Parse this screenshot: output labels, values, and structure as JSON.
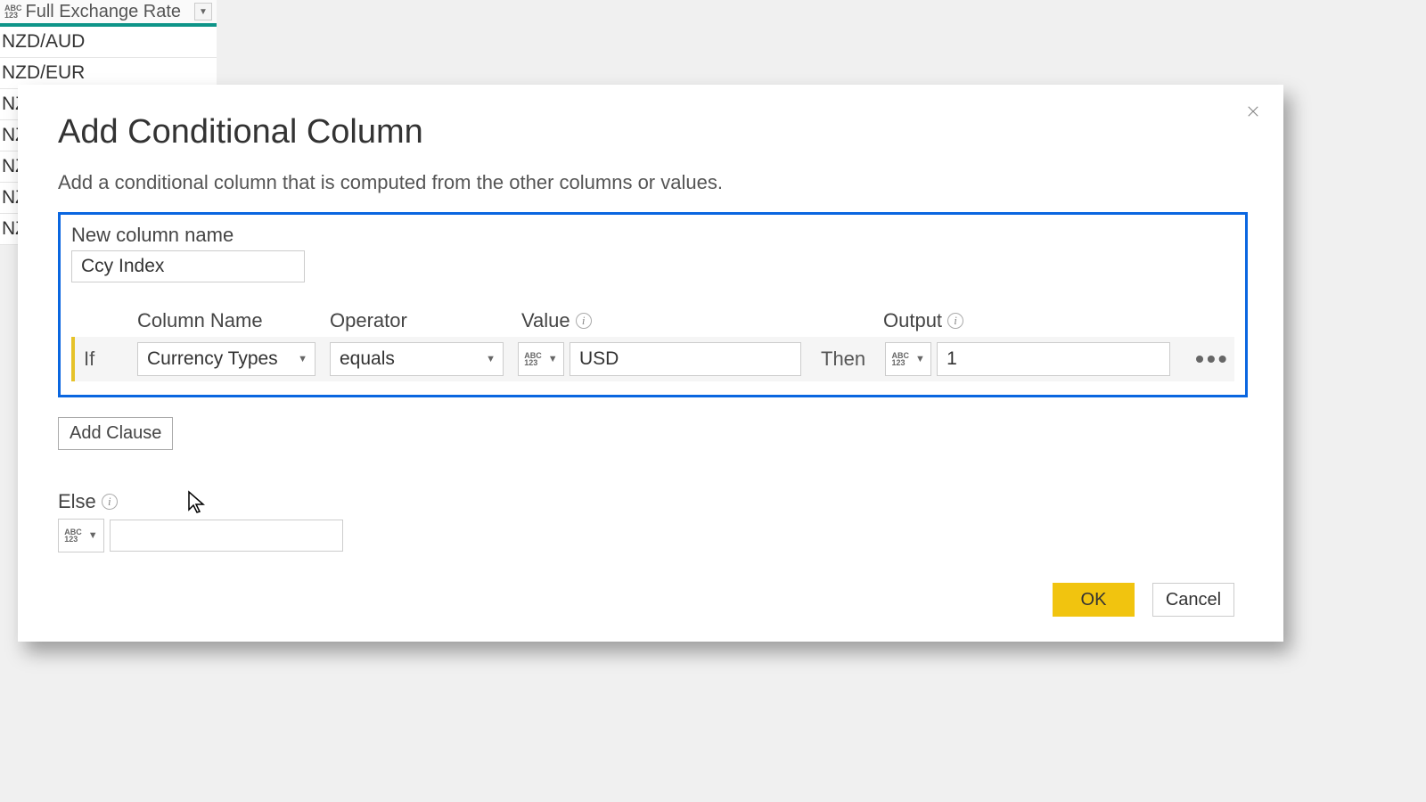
{
  "background": {
    "column_header": "Full Exchange Rate",
    "type_badge": "ABC\n123",
    "rows": [
      "NZD/AUD",
      "NZD/EUR",
      "NZ",
      "NZ",
      "NZ",
      "NZ",
      "NZ"
    ]
  },
  "dialog": {
    "title": "Add Conditional Column",
    "subtitle": "Add a conditional column that is computed from the other columns or values.",
    "new_column_label": "New column name",
    "new_column_value": "Ccy Index",
    "headers": {
      "column_name": "Column Name",
      "operator": "Operator",
      "value": "Value",
      "output": "Output"
    },
    "clause": {
      "if_label": "If",
      "column_name": "Currency Types",
      "operator": "equals",
      "value_type": "ABC\n123",
      "value": "USD",
      "then_label": "Then",
      "output_type": "ABC\n123",
      "output": "1"
    },
    "add_clause_label": "Add Clause",
    "else": {
      "label": "Else",
      "type": "ABC\n123",
      "value": ""
    },
    "buttons": {
      "ok": "OK",
      "cancel": "Cancel"
    }
  }
}
